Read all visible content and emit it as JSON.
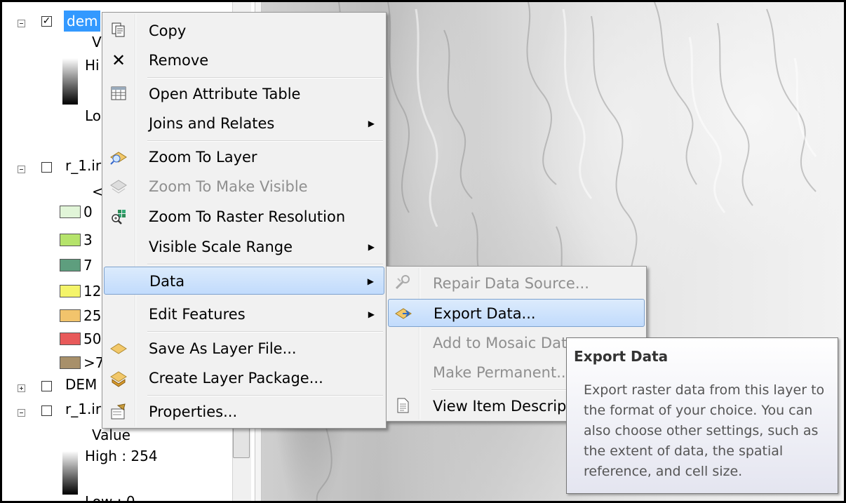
{
  "toc": {
    "layers": [
      {
        "name": "dem",
        "checked": true,
        "expanded": true,
        "selected": true
      },
      {
        "name": "r_1.ir",
        "checked": false,
        "expanded": true
      },
      {
        "name": "DEM",
        "checked": false,
        "expanded": false
      },
      {
        "name": "r_1.ir",
        "checked": false,
        "expanded": true
      }
    ],
    "dem_legend": {
      "field": "V",
      "high": "Hi",
      "low": "Lo"
    },
    "r1_legend": {
      "field": "<",
      "classes": [
        {
          "label": "0",
          "color": "#e1f5d8"
        },
        {
          "label": "3",
          "color": "#b5e36b"
        },
        {
          "label": "7",
          "color": "#5e9e7e"
        },
        {
          "label": "12",
          "color": "#f4f46a"
        },
        {
          "label": "25",
          "color": "#f2c46c"
        },
        {
          "label": "50",
          "color": "#e85a5a"
        },
        {
          "label": ">7",
          "color": "#a8906a"
        }
      ]
    },
    "r1b_legend": {
      "field": "Value",
      "high": "High : 254",
      "low": "Low : 0"
    }
  },
  "menu": {
    "items": [
      {
        "label": "Copy",
        "icon": "copy-icon"
      },
      {
        "label": "Remove",
        "icon": "remove-icon"
      },
      {
        "label": "Open Attribute Table",
        "icon": "table-icon"
      },
      {
        "label": "Joins and Relates",
        "submenu": true
      },
      {
        "label": "Zoom To Layer",
        "icon": "zoom-to-layer-icon"
      },
      {
        "label": "Zoom To Make Visible",
        "icon": "zoom-visible-icon",
        "disabled": true
      },
      {
        "label": "Zoom To Raster Resolution",
        "icon": "raster-resolution-icon"
      },
      {
        "label": "Visible Scale Range",
        "submenu": true
      },
      {
        "label": "Data",
        "submenu": true,
        "highlighted": true
      },
      {
        "label": "Edit Features",
        "submenu": true
      },
      {
        "label": "Save As Layer File...",
        "icon": "layer-file-icon"
      },
      {
        "label": "Create Layer Package...",
        "icon": "layer-package-icon"
      },
      {
        "label": "Properties...",
        "icon": "properties-icon"
      }
    ]
  },
  "submenu": {
    "items": [
      {
        "label": "Repair Data Source...",
        "icon": "repair-icon",
        "disabled": true
      },
      {
        "label": "Export Data...",
        "icon": "export-data-icon",
        "highlighted": true
      },
      {
        "label": "Add to Mosaic Dat",
        "disabled": true
      },
      {
        "label": "Make Permanent...",
        "disabled": true
      },
      {
        "label": "View Item Descript",
        "icon": "item-description-icon"
      }
    ]
  },
  "tooltip": {
    "title": "Export Data",
    "body": "Export raster data from this layer to the format of your choice. You can also choose other settings, such as the extent of data, the spatial reference, and cell size."
  }
}
